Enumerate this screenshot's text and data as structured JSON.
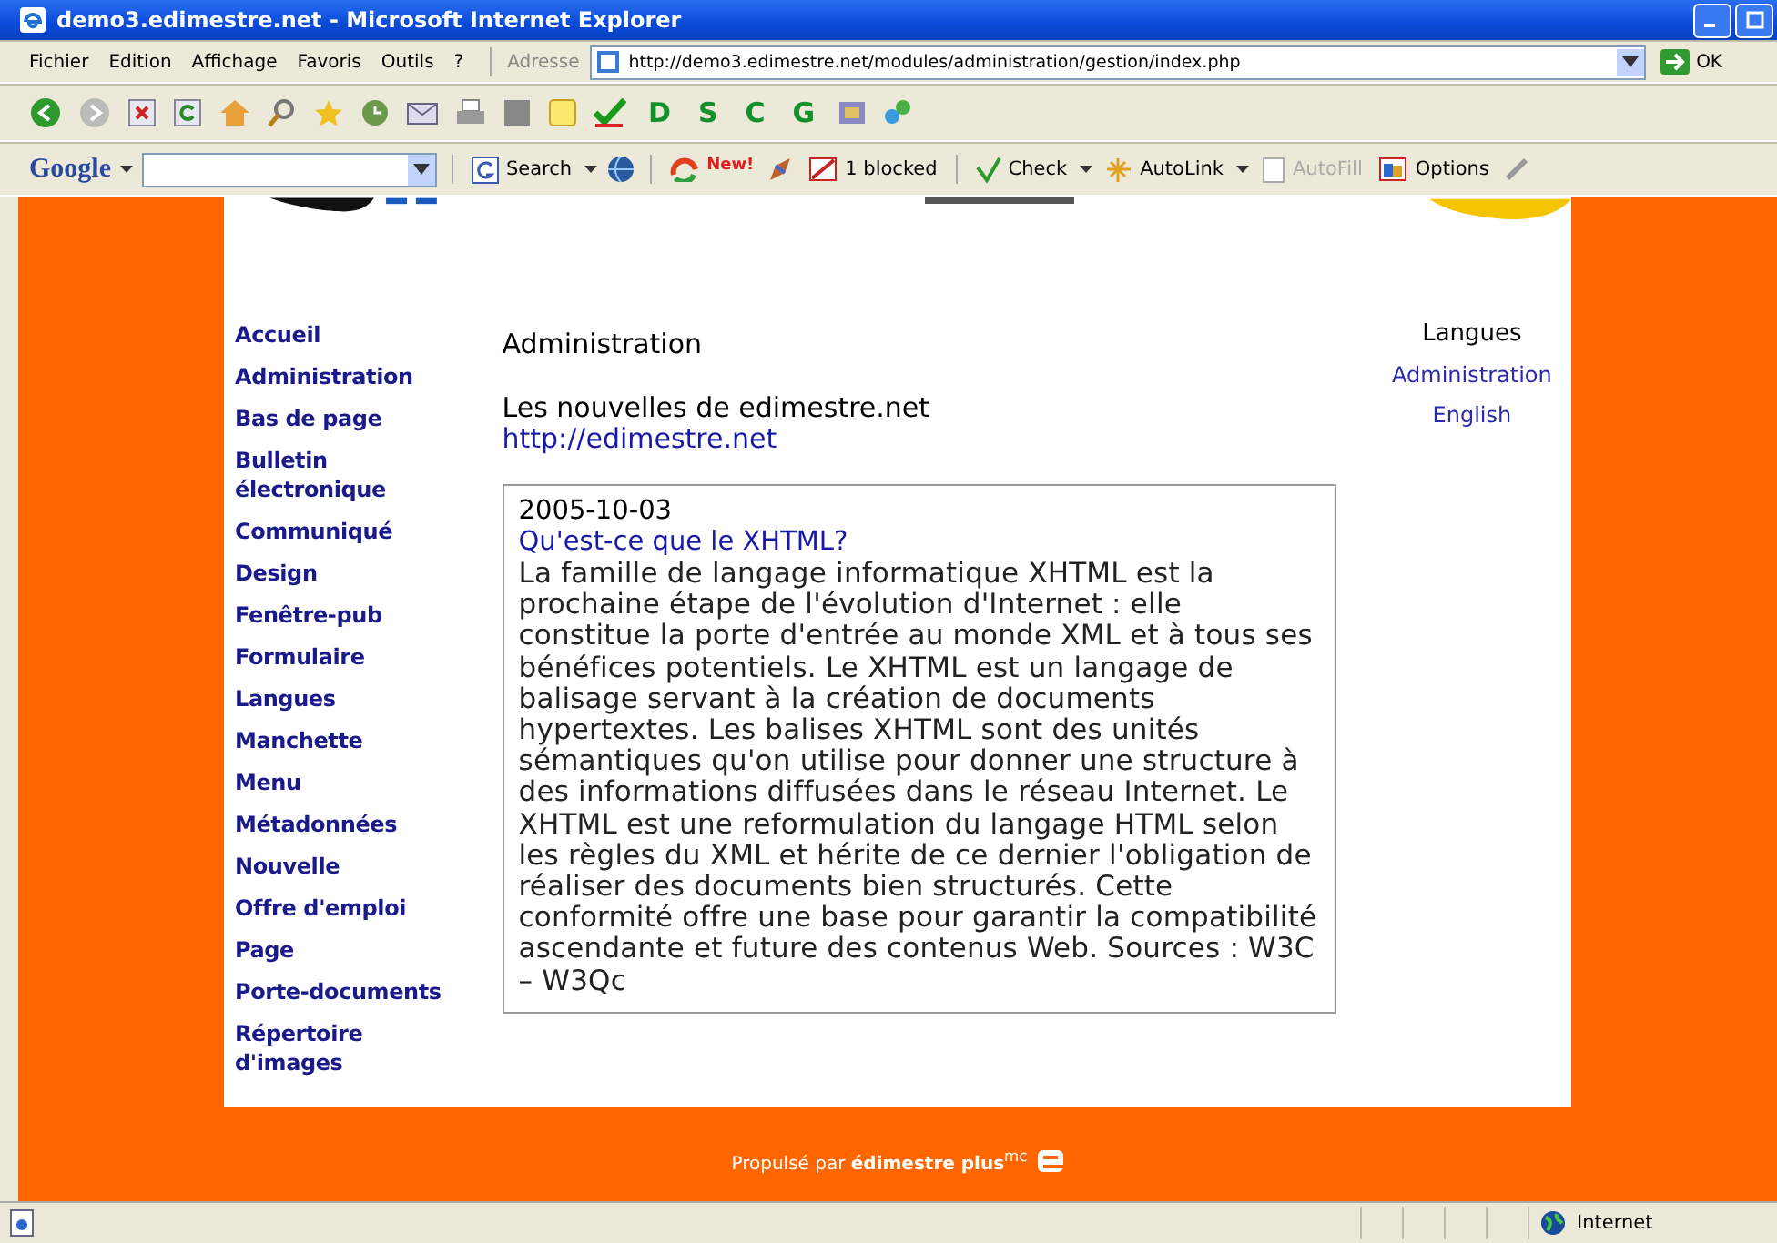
{
  "window": {
    "title": "demo3.edimestre.net - Microsoft Internet Explorer"
  },
  "menu": [
    "Fichier",
    "Edition",
    "Affichage",
    "Favoris",
    "Outils",
    "?"
  ],
  "address": {
    "label": "Adresse",
    "url": "http://demo3.edimestre.net/modules/administration/gestion/index.php",
    "go": "OK"
  },
  "toolbar": {
    "letters": [
      "D",
      "S",
      "C",
      "G"
    ]
  },
  "google_bar": {
    "logo": "Google",
    "search": "Search",
    "new_badge": "New!",
    "blocked": "1 blocked",
    "check": "Check",
    "autolink": "AutoLink",
    "autofill": {
      "label": "AutoFill",
      "disabled": true
    },
    "options": "Options"
  },
  "nav": [
    "Accueil",
    "Administration",
    "Bas de page",
    "Bulletin électronique",
    "Communiqué",
    "Design",
    "Fenêtre-pub",
    "Formulaire",
    "Langues",
    "Manchette",
    "Menu",
    "Métadonnées",
    "Nouvelle",
    "Offre d'emploi",
    "Page",
    "Porte-documents",
    "Répertoire d'images"
  ],
  "main": {
    "heading": "Administration",
    "news_title": "Les nouvelles de edimestre.net",
    "news_link": "http://edimestre.net",
    "article": {
      "date": "2005-10-03",
      "title": "Qu'est-ce que le XHTML?",
      "body": "La famille de langage informatique XHTML est la prochaine étape de l'évolution d'Internet : elle constitue la porte d'entrée au monde XML et à tous ses bénéfices potentiels. Le XHTML est un langage de balisage servant à la création de documents hypertextes. Les balises XHTML sont des unités sémantiques qu'on utilise pour donner une structure à des informations diffusées dans le réseau Internet. Le XHTML est une reformulation du langage HTML selon les règles du XML et hérite de ce dernier l'obligation de réaliser des documents bien structurés. Cette conformité offre une base pour garantir la compatibilité ascendante et future des contenus Web. Sources : W3C – W3Qc"
    }
  },
  "languages": {
    "heading": "Langues",
    "links": [
      "Administration",
      "English"
    ]
  },
  "footer": "Propulsé par **édimestre plus**$^{mc}$",
  "status_bar": {
    "zone": "Internet"
  }
}
